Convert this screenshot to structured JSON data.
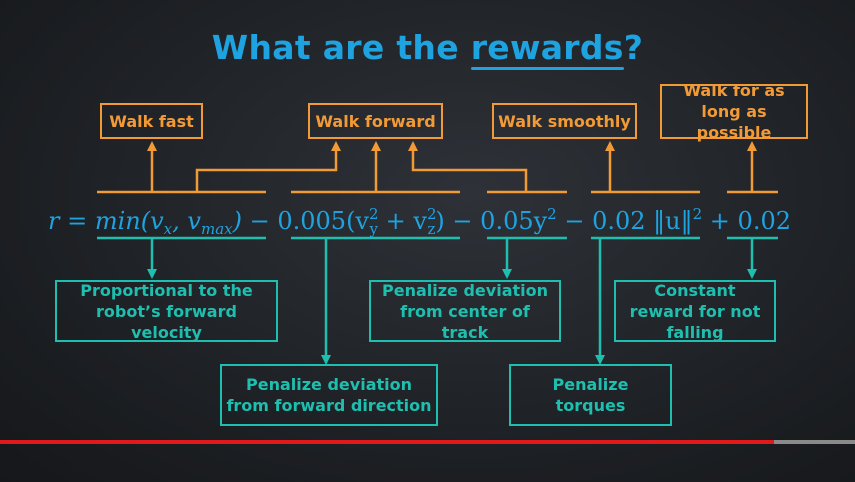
{
  "title": {
    "prefix": "What are the",
    "keyword": "rewards",
    "suffix": "?"
  },
  "formula": {
    "r_eq": "r =",
    "min_open": "min(v",
    "sub_x": "x",
    "comma": ", v",
    "sub_max": "max",
    "close": ")",
    "minus1": " − ",
    "coef1": "0.005(v",
    "sup_y": "2",
    "sub_y": "y",
    "plus_v": " + v",
    "sup_z": "2",
    "sub_z": "z",
    "close2": ")",
    "minus2": " − ",
    "term3": "0.05y",
    "sup3": "2",
    "minus3": " − ",
    "term4": "0.02 ‖u‖",
    "sup4": "2",
    "plus5": " + ",
    "term5": "0.02"
  },
  "top_labels": [
    "Walk fast",
    "Walk forward",
    "Walk smoothly",
    "Walk for as long as possible"
  ],
  "bottom_labels": [
    "Proportional to the robot’s forward velocity",
    "Penalize deviation from forward direction",
    "Penalize deviation from center of track",
    "Penalize torques",
    "Constant reward for not falling"
  ],
  "colors": {
    "title": "#1ea3e0",
    "formula": "#1ea3e0",
    "goal_boxes": "#f29a36",
    "explanation_boxes": "#1fbfb0",
    "progress": "#e01a1a"
  },
  "playback": {
    "progress_fraction": 0.905
  }
}
